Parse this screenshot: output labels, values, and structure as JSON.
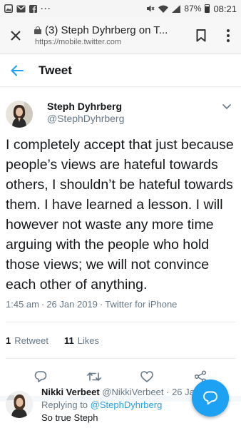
{
  "status_bar": {
    "battery": "87%",
    "time": "08:21",
    "overflow": "···"
  },
  "browser": {
    "page_title": "(3) Steph Dyhrberg on T...",
    "url": "https://mobile.twitter.com"
  },
  "header": {
    "title": "Tweet"
  },
  "tweet": {
    "author_name": "Steph Dyhrberg",
    "author_handle": "@StephDyhrberg",
    "text": "I completely accept that just because people’s views are hateful towards others, I shouldn’t be hateful towards them. I have learned a lesson. I will however not waste any more time arguing with the people who hold those views; we will not convince each other of anything.",
    "time": "1:45 am",
    "date": "26 Jan 2019",
    "source": "Twitter for iPhone",
    "separator": "·",
    "retweets_count": "1",
    "retweets_label": "Retweet",
    "likes_count": "11",
    "likes_label": "Likes"
  },
  "reply": {
    "author_name": "Nikki Verbeet",
    "author_handle": "@NikkiVerbeet",
    "separator": "·",
    "date": "26 Ja",
    "replying_prefix": "Replying to",
    "replying_to": "@StephDyhrberg",
    "text": "So true Steph"
  },
  "icons": {
    "accent": "#1da1f2",
    "muted": "#657786"
  }
}
